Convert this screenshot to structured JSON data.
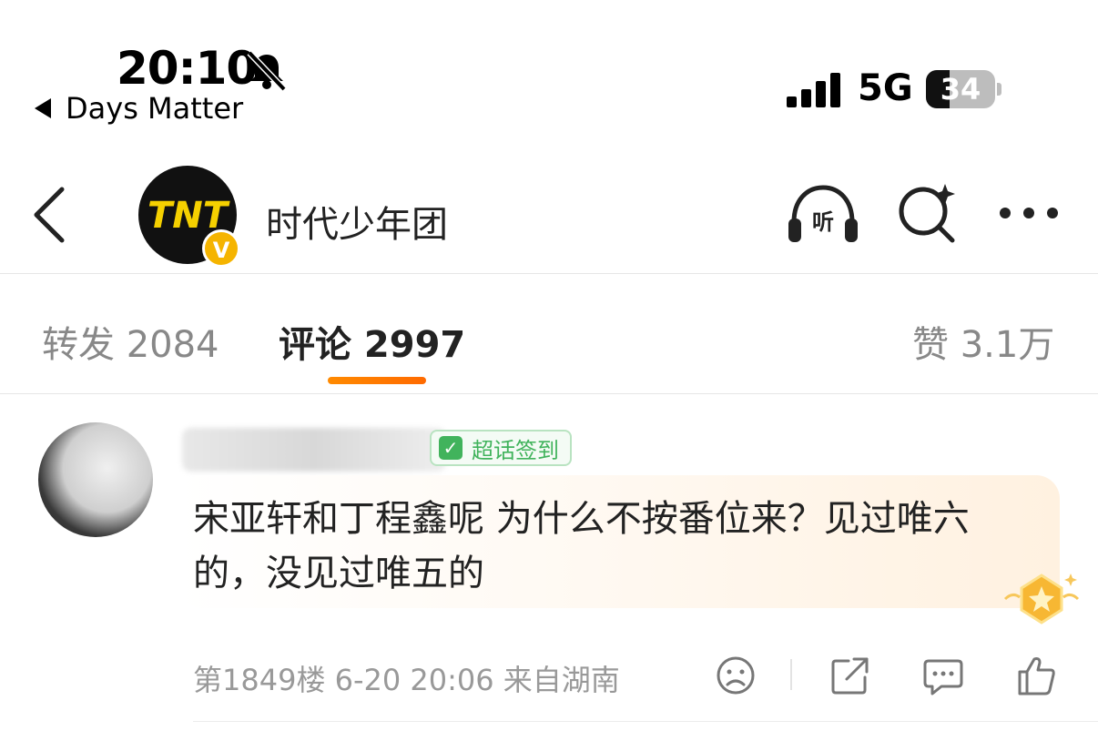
{
  "status_bar": {
    "time": "20:10",
    "back_app": "Days Matter",
    "network": "5G",
    "battery_level": "34",
    "battery_fraction": 0.34
  },
  "nav": {
    "account_name": "时代少年团",
    "avatar_text": "TNT",
    "verified_mark": "V"
  },
  "tabs": [
    {
      "label": "转发 2084"
    },
    {
      "label": "评论 2997"
    },
    {
      "label": "赞 3.1万"
    }
  ],
  "comment": {
    "badge": "超话签到",
    "text": "宋亚轩和丁程鑫呢 为什么不按番位来？见过唯六的，没见过唯五的",
    "meta": "第1849楼 6-20 20:06 来自湖南"
  },
  "colors": {
    "accent_orange": "#ff7a00",
    "badge_green": "#41b35c",
    "verify_yellow": "#f5b400"
  }
}
